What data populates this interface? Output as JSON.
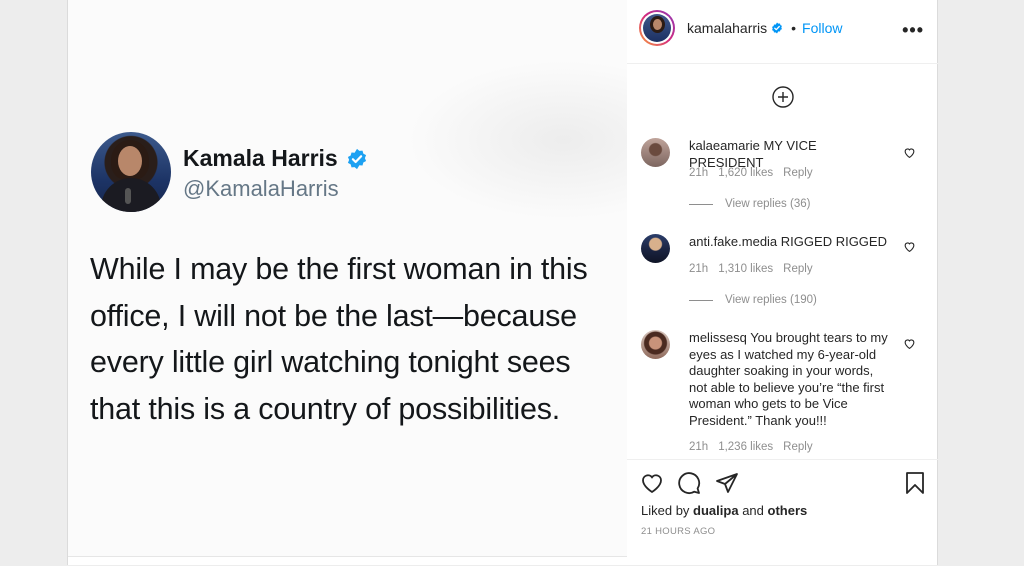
{
  "tweet": {
    "name": "Kamala Harris",
    "handle": "@KamalaHarris",
    "text": "While I may be the first woman in this office, I will not be the last—because every little girl watching tonight sees that this is a country of possibilities."
  },
  "header": {
    "username": "kamalaharris",
    "separator": "•",
    "follow_label": "Follow",
    "more_label": "•••"
  },
  "comments": [
    {
      "user": "kalaeamarie",
      "text": "MY VICE PRESIDENT",
      "age": "21h",
      "likes": "1,620 likes",
      "reply_label": "Reply",
      "view_replies": "View replies (36)"
    },
    {
      "user": "anti.fake.media",
      "text": "RIGGED RIGGED",
      "age": "21h",
      "likes": "1,310 likes",
      "reply_label": "Reply",
      "view_replies": "View replies (190)"
    },
    {
      "user": "melissesq",
      "text": "You brought tears to my eyes as I watched my 6-year-old daughter soaking in your words, not able to believe you’re “the first woman who gets to be Vice President.” Thank you!!!",
      "age": "21h",
      "likes": "1,236 likes",
      "reply_label": "Reply"
    }
  ],
  "footer": {
    "liked_prefix": "Liked by",
    "liked_user": "dualipa",
    "liked_and": "and",
    "liked_others": "others",
    "timestamp": "21 HOURS AGO"
  },
  "colors": {
    "accent": "#0095f6",
    "verified": "#1da1f2",
    "text": "#262626",
    "muted": "#8e8e8e"
  },
  "icons": [
    "verified-icon",
    "more-icon",
    "add-comment-icon",
    "heart-icon",
    "comment-icon",
    "share-icon",
    "bookmark-icon"
  ]
}
